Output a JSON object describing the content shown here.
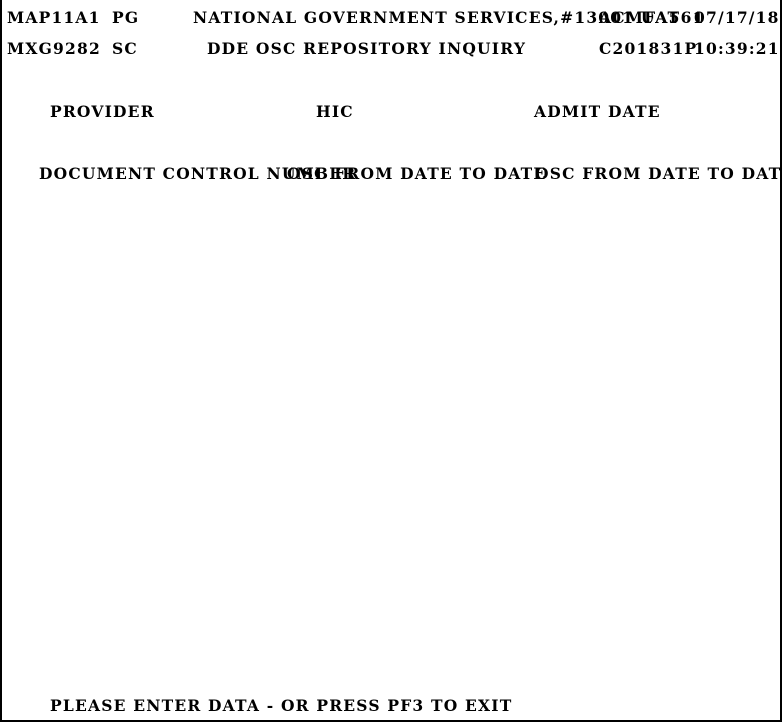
{
  "screen": {
    "name": "DDE OSC REPOSITORY INQUIRY",
    "columns": 80,
    "rows": 24,
    "foreground_color": "#000000",
    "background_color": "#ffffff",
    "border_color": "#000000"
  },
  "header": {
    "map_id": "MAP11A1",
    "page_indicator": "PG",
    "organization": "NATIONAL GOVERNMENT SERVICES,#13001 UAT",
    "transaction_id": "ACMFA561",
    "date": "07/17/18",
    "terminal_id": "MXG9282",
    "screen_code": "SC",
    "title": "DDE OSC REPOSITORY INQUIRY",
    "session_id": "C201831P",
    "time": "10:39:21"
  },
  "key_fields": {
    "provider_label": "PROVIDER",
    "provider_value": "",
    "hic_label": "HIC",
    "hic_value": "",
    "admit_date_label": "ADMIT DATE",
    "admit_date_value": ""
  },
  "column_headers": {
    "dcn": "DOCUMENT CONTROL NUMBER",
    "osc_group_1": "OSC FROM DATE TO DATE",
    "osc_group_2": "OSC FROM DATE TO DATE"
  },
  "detail_rows": [],
  "footer": {
    "message": "PLEASE ENTER DATA - OR PRESS PF3 TO EXIT"
  }
}
